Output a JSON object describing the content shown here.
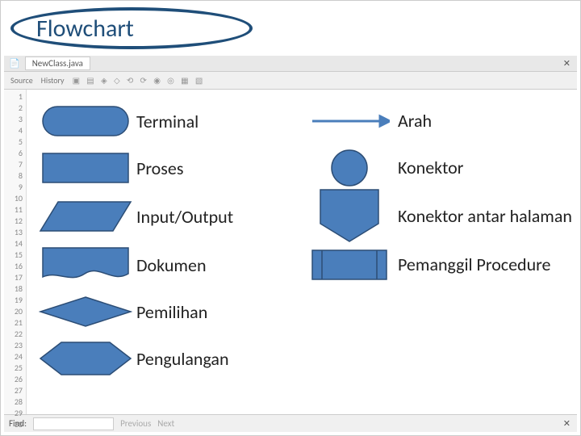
{
  "title": "Flowchart",
  "ide": {
    "tab": "NewClass.java",
    "sub1": "Source",
    "sub2": "History",
    "find": "Find:",
    "prev": "Previous",
    "next": "Next"
  },
  "left": [
    {
      "label": "Terminal"
    },
    {
      "label": "Proses"
    },
    {
      "label": "Input/Output"
    },
    {
      "label": "Dokumen"
    },
    {
      "label": "Pemilihan"
    },
    {
      "label": "Pengulangan"
    }
  ],
  "right": [
    {
      "label": "Arah"
    },
    {
      "label": "Konektor"
    },
    {
      "label": "Konektor antar halaman"
    },
    {
      "label": "Pemanggil Procedure"
    }
  ]
}
